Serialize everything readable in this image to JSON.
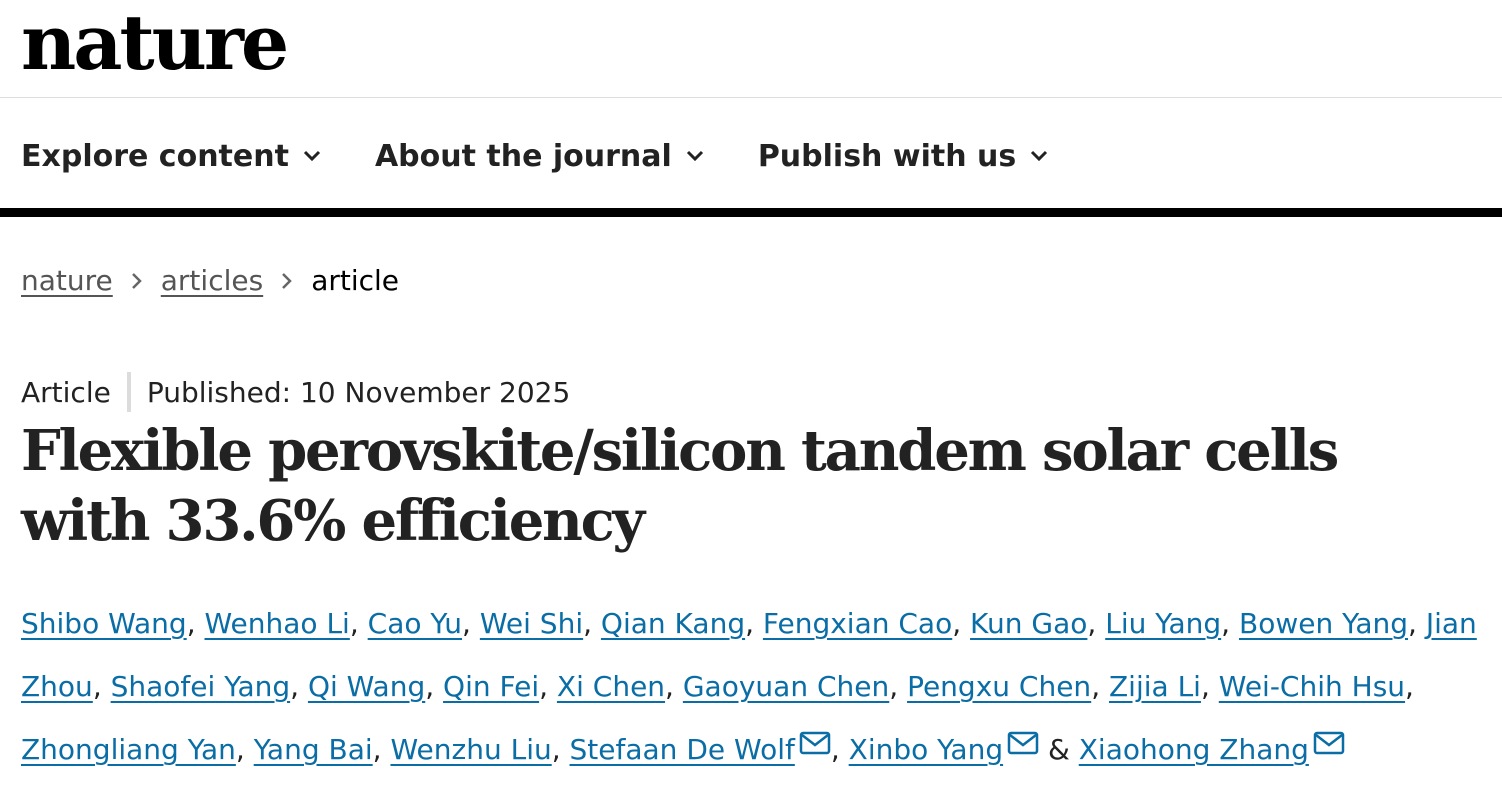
{
  "site": {
    "logo_text": "nature"
  },
  "nav": {
    "items": [
      {
        "label": "Explore content",
        "icon": "chevron-down-icon"
      },
      {
        "label": "About the journal",
        "icon": "chevron-down-icon"
      },
      {
        "label": "Publish with us",
        "icon": "chevron-down-icon"
      }
    ]
  },
  "breadcrumb": {
    "items": [
      {
        "label": "nature",
        "link": true
      },
      {
        "label": "articles",
        "link": true
      },
      {
        "label": "article",
        "link": false
      }
    ],
    "separator_icon": "chevron-right-icon"
  },
  "article": {
    "type": "Article",
    "published": "Published: 10 November 2025",
    "title": "Flexible perovskite/silicon tandem solar cells with 33.6% efficiency",
    "authors": [
      "Shibo Wang",
      "Wenhao Li",
      "Cao Yu",
      "Wei Shi",
      "Qian Kang",
      "Fengxian Cao",
      "Kun Gao",
      "Liu Yang",
      "Bowen Yang",
      "Jian Zhou",
      "Shaofei Yang",
      "Qi Wang",
      "Qin Fei",
      "Xi Chen",
      "Gaoyuan Chen",
      "Pengxu Chen",
      "Zijia Li",
      "Wei-Chih Hsu",
      "Zhongliang Yan",
      "Yang Bai",
      "Wenzhu Liu",
      "Stefaan De Wolf",
      "Xinbo Yang",
      "Xiaohong Zhang"
    ],
    "corresponding_authors": [
      "Stefaan De Wolf",
      "Xinbo Yang",
      "Xiaohong Zhang"
    ],
    "author_separator": ", ",
    "last_author_joiner": " & ",
    "mail_icon": "envelope-icon"
  },
  "colors": {
    "text": "#222222",
    "link": "#0a6da6",
    "breadcrumb_link": "#555555",
    "nav_rule": "#000000"
  }
}
